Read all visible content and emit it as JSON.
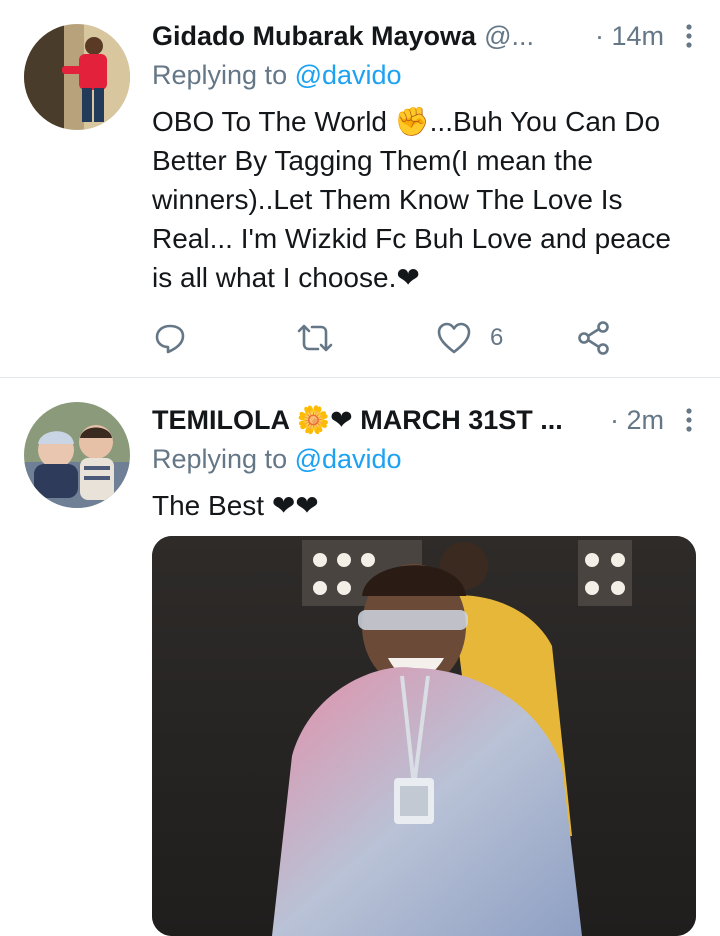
{
  "tweets": [
    {
      "author_name": "Gidado Mubarak Mayowa",
      "handle": "@...",
      "time": "· 14m",
      "replying_prefix": "Replying to ",
      "replying_to": "@davido",
      "text": "OBO To The World ✊...Buh You Can Do Better By Tagging Them(I mean the winners)..Let Them Know The Love Is Real... I'm Wizkid Fc Buh Love and peace is all what I choose.❤",
      "reply_count": "",
      "retweet_count": "",
      "like_count": "6",
      "icons": {
        "more": "more-vertical-icon",
        "reply": "reply-icon",
        "retweet": "retweet-icon",
        "like": "heart-icon",
        "share": "share-icon"
      }
    },
    {
      "author_name": "TEMILOLA 🌼❤ MARCH 31ST ...",
      "time": "· 2m",
      "replying_prefix": "Replying to ",
      "replying_to": "@davido",
      "text": "The Best ❤❤",
      "icons": {
        "more": "more-vertical-icon"
      }
    }
  ],
  "colors": {
    "link": "#1da1f2",
    "secondary_text": "#657786",
    "primary_text": "#14171a",
    "divider": "#e1e8ed"
  }
}
